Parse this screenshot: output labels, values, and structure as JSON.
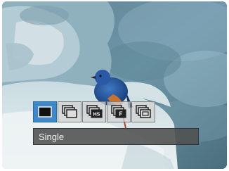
{
  "drive_mode_menu": {
    "options": [
      {
        "icon": "single-shot-icon",
        "selected": true
      },
      {
        "icon": "continuous-shot-icon",
        "selected": false
      },
      {
        "icon": "high-speed-burst-icon",
        "badge": "HS",
        "selected": false
      },
      {
        "icon": "fast-burst-icon",
        "badge": "F",
        "selected": false
      },
      {
        "icon": "continuous-variant-icon",
        "selected": false
      }
    ],
    "selected_label": "Single"
  },
  "colors": {
    "selected_button": "#3f88c9",
    "button": "#d2d2d2",
    "caption_bar": "#4e4e4e",
    "caption_text": "#f2f2f2"
  }
}
